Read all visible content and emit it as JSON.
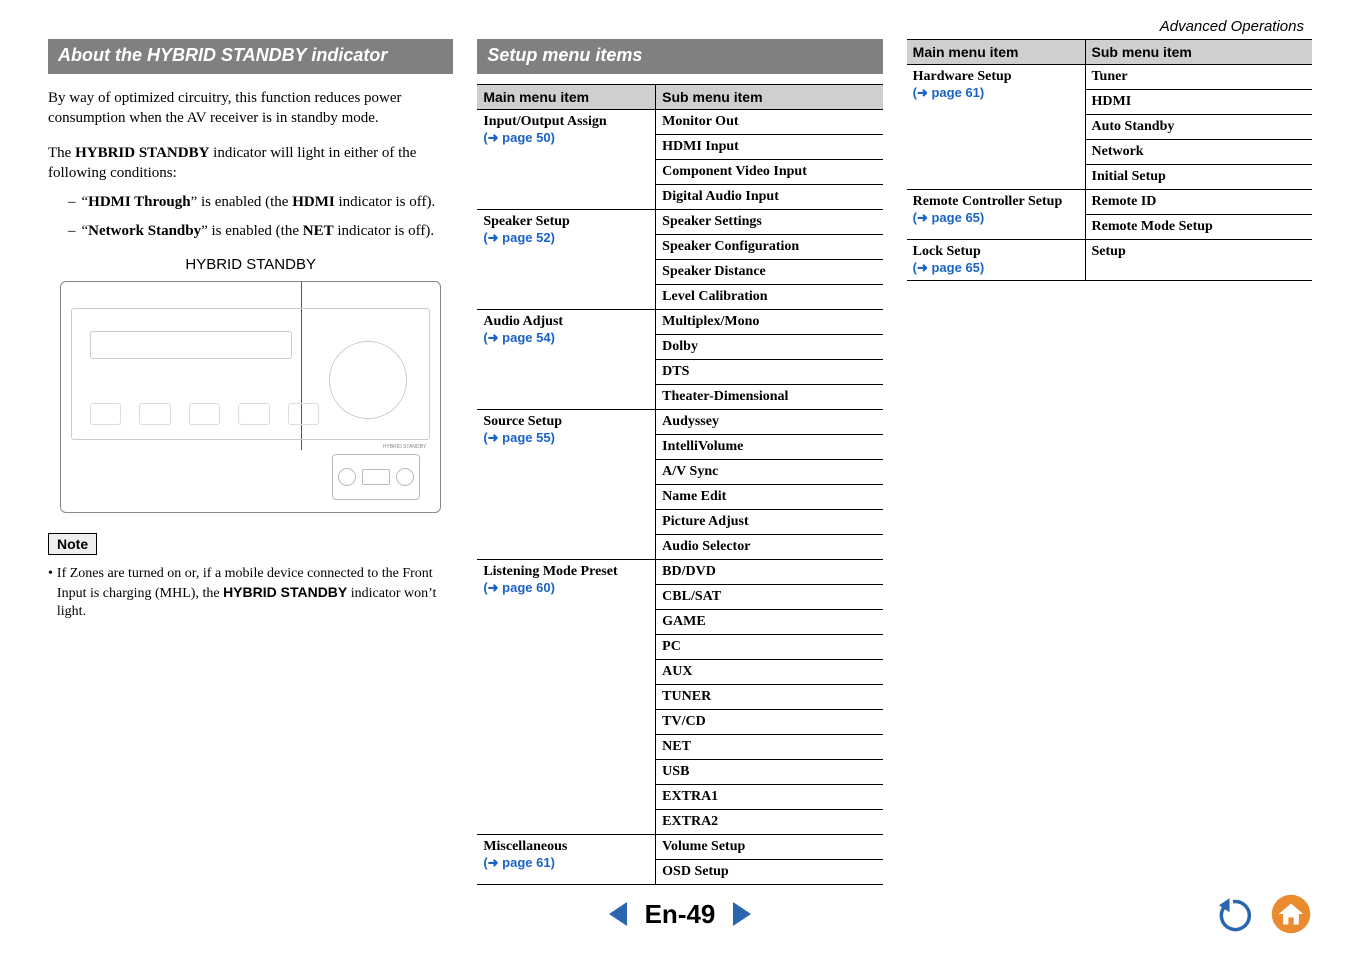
{
  "header": {
    "section": "Advanced Operations"
  },
  "col1": {
    "heading": "About the HYBRID STANDBY indicator",
    "p1_a": "By way of optimized circuitry, this function reduces power consumption when the AV receiver is in standby mode.",
    "p1_b_pre": "The ",
    "p1_b_bold": "HYBRID STANDBY",
    "p1_b_post": " indicator will light in either of the following conditions:",
    "bul1_pre": "“",
    "bul1_bold1": "HDMI Through",
    "bul1_mid": "” is enabled (the ",
    "bul1_bold2": "HDMI",
    "bul1_post": " indicator is off).",
    "bul2_pre": "“",
    "bul2_bold1": "Network Standby",
    "bul2_mid": "” is enabled (the ",
    "bul2_bold2": "NET",
    "bul2_post": " indicator is off).",
    "caption": "HYBRID STANDBY",
    "note_label": "Note",
    "note_pre": "If Zones are turned on or, if a mobile device connected to the Front Input is charging (MHL), the ",
    "note_bold": "HYBRID STANDBY",
    "note_post": " indicator won’t light."
  },
  "col2": {
    "heading": "Setup menu items",
    "th_main": "Main menu item",
    "th_sub": "Sub menu item",
    "groups": [
      {
        "title": "Input/Output Assign",
        "ref": "page 50",
        "subs": [
          "Monitor Out",
          "HDMI Input",
          "Component Video Input",
          "Digital Audio Input"
        ]
      },
      {
        "title": "Speaker Setup",
        "ref": "page 52",
        "subs": [
          "Speaker Settings",
          "Speaker Configuration",
          "Speaker Distance",
          "Level Calibration"
        ]
      },
      {
        "title": "Audio Adjust",
        "ref": "page 54",
        "subs": [
          "Multiplex/Mono",
          "Dolby",
          "DTS",
          "Theater-Dimensional"
        ]
      },
      {
        "title": "Source Setup",
        "ref": "page 55",
        "subs": [
          "Audyssey",
          "IntelliVolume",
          "A/V Sync",
          "Name Edit",
          "Picture Adjust",
          "Audio Selector"
        ]
      },
      {
        "title": "Listening Mode Preset",
        "ref": "page 60",
        "subs": [
          "BD/DVD",
          "CBL/SAT",
          "GAME",
          "PC",
          "AUX",
          "TUNER",
          "TV/CD",
          "NET",
          "USB",
          "EXTRA1",
          "EXTRA2"
        ]
      },
      {
        "title": "Miscellaneous",
        "ref": "page 61",
        "subs": [
          "Volume Setup",
          "OSD Setup"
        ]
      }
    ]
  },
  "col3": {
    "th_main": "Main menu item",
    "th_sub": "Sub menu item",
    "groups": [
      {
        "title": "Hardware Setup",
        "ref": "page 61",
        "subs": [
          "Tuner",
          "HDMI",
          "Auto Standby",
          "Network",
          "Initial Setup"
        ]
      },
      {
        "title": "Remote Controller Setup",
        "ref": "page 65",
        "subs": [
          "Remote ID",
          "Remote Mode Setup"
        ]
      },
      {
        "title": "Lock Setup",
        "ref": "page 65",
        "subs": [
          "Setup"
        ]
      }
    ]
  },
  "pageref_prefix": "(➜ ",
  "pageref_suffix": ")",
  "footer": {
    "page": "En-49"
  }
}
